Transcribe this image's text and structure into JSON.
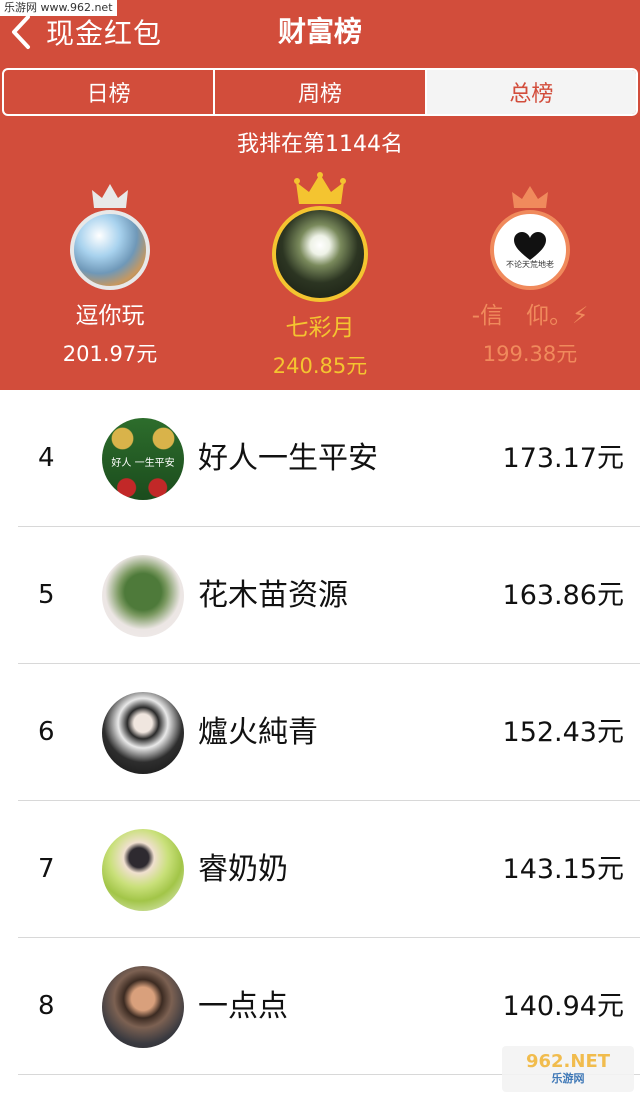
{
  "watermark": {
    "top_left": "乐游网 www.962.net",
    "bottom_right_logo": "962.NET",
    "bottom_right_sub": "乐游网"
  },
  "navbar": {
    "back_label": "现金红包",
    "title": "财富榜"
  },
  "tabs": [
    {
      "label": "日榜",
      "active": false
    },
    {
      "label": "周榜",
      "active": false
    },
    {
      "label": "总榜",
      "active": true
    }
  ],
  "my_rank": "我排在第1144名",
  "podium": {
    "first": {
      "name": "七彩月",
      "amount": "240.85元",
      "crown_color": "#f4c430"
    },
    "second": {
      "name": "逗你玩",
      "amount": "201.97元",
      "crown_color": "#e8e8e8"
    },
    "third": {
      "name": "-信　仰。⚡",
      "amount": "199.38元",
      "crown_color": "#f08a5c",
      "avatar_text": "不论天荒地老"
    }
  },
  "leaderboard": [
    {
      "rank": "4",
      "name": "好人一生平安",
      "amount": "173.17元",
      "avatar_text": "好人 一生平安"
    },
    {
      "rank": "5",
      "name": "花木苗资源",
      "amount": "163.86元"
    },
    {
      "rank": "6",
      "name": "爐火純青",
      "amount": "152.43元"
    },
    {
      "rank": "7",
      "name": "睿奶奶",
      "amount": "143.15元"
    },
    {
      "rank": "8",
      "name": "一点点",
      "amount": "140.94元"
    }
  ],
  "colors": {
    "header_bg": "#d24d3b",
    "gold": "#f4c430",
    "silver": "#e8e8e8",
    "bronze": "#f08a5c",
    "white": "#ffffff"
  }
}
